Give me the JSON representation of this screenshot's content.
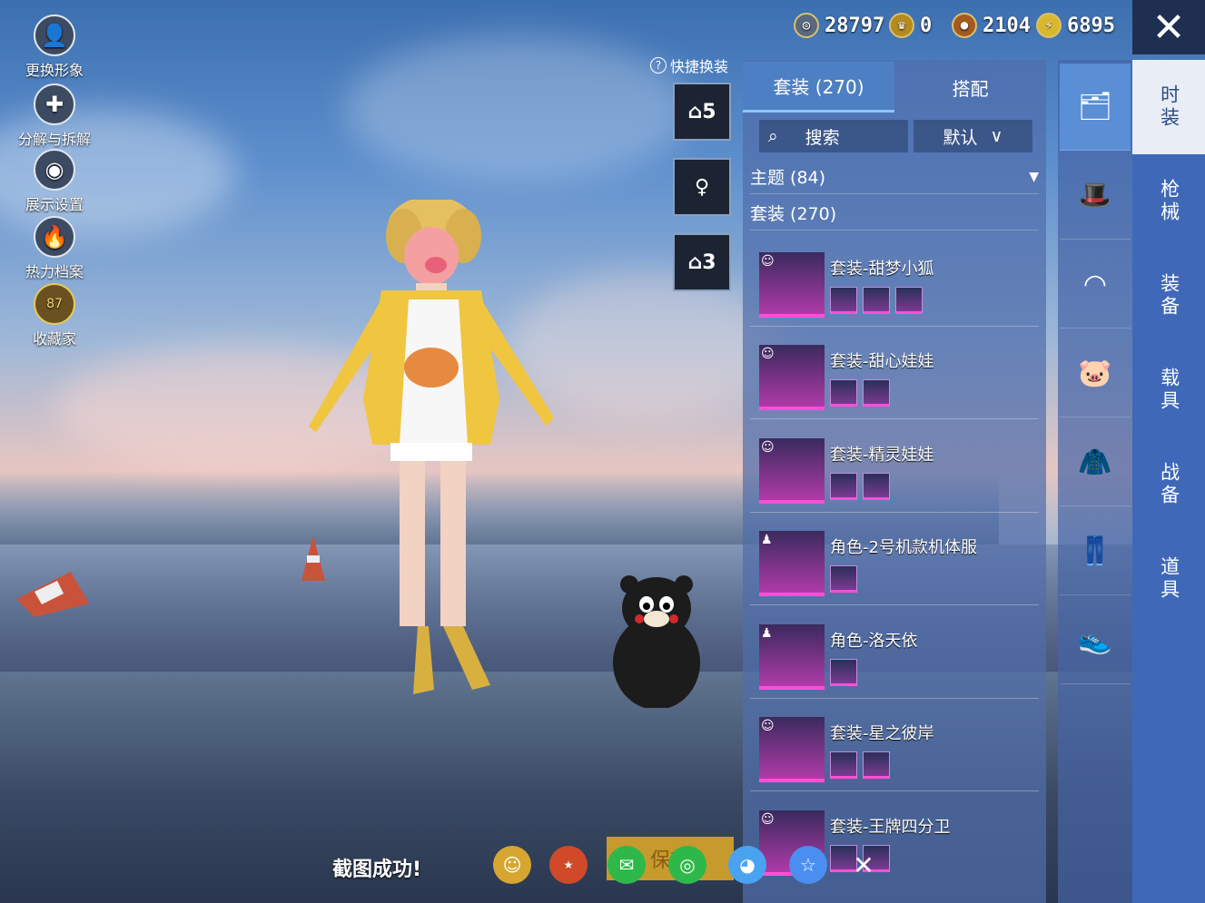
{
  "resources": [
    {
      "icon": "silver-coin-icon",
      "value": "28797"
    },
    {
      "icon": "crown-coin-icon",
      "value": "0"
    },
    {
      "icon": "bronze-coin-icon",
      "value": "2104"
    },
    {
      "icon": "lightning-coin-icon",
      "value": "6895"
    }
  ],
  "left_menu": [
    {
      "label": "更换形象",
      "icon": "avatar-icon"
    },
    {
      "label": "分解与拆解",
      "icon": "puzzle-icon"
    },
    {
      "label": "展示设置",
      "icon": "eye-icon"
    },
    {
      "label": "热力档案",
      "icon": "flame-icon"
    },
    {
      "label": "收藏家",
      "icon": "collector-badge-icon",
      "badge": "87"
    }
  ],
  "quick_change": {
    "label": "快捷换装",
    "slots": [
      "5",
      "",
      "3"
    ]
  },
  "tabs": [
    {
      "label": "套装 (270)",
      "active": true
    },
    {
      "label": "搭配",
      "active": false
    }
  ],
  "search": {
    "label": "搜索"
  },
  "sort": {
    "label": "默认"
  },
  "categories": [
    {
      "label": "主题 (84)"
    },
    {
      "label": "套装 (270)"
    }
  ],
  "items": [
    {
      "name": "套装-甜梦小狐",
      "parts": 3
    },
    {
      "name": "套装-甜心娃娃",
      "parts": 2
    },
    {
      "name": "套装-精灵娃娃",
      "parts": 2
    },
    {
      "name": "角色-2号机款机体服",
      "parts": 1
    },
    {
      "name": "角色-洛天依",
      "parts": 1
    },
    {
      "name": "套装-星之彼岸",
      "parts": 2
    },
    {
      "name": "套装-王牌四分卫",
      "parts": 2
    }
  ],
  "right_categories": [
    "时装",
    "枪械",
    "装备",
    "载具",
    "战备",
    "道具"
  ],
  "bottom": {
    "screenshot_msg": "截图成功!",
    "save_label": "保存"
  },
  "colors": {
    "accent": "#4d7fc4",
    "rarity": "#ff4fd8",
    "active_cat": "#e9eef6"
  }
}
